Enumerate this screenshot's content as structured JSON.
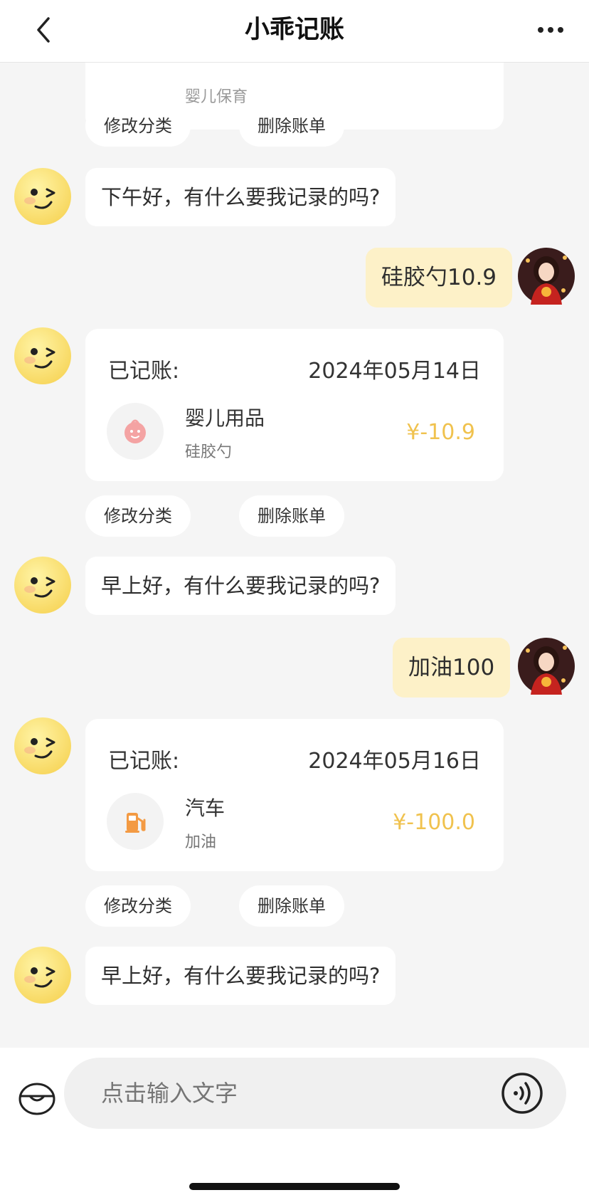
{
  "header": {
    "title": "小乖记账",
    "back_icon": "chevron-left-icon",
    "more_icon": "more-horizontal-icon"
  },
  "chat": {
    "partial_top": {
      "cat_note": "婴儿保育"
    },
    "top_actions": {
      "edit_label": "修改分类",
      "delete_label": "删除账单"
    },
    "msg1": {
      "text": "下午好，有什么要我记录的吗?"
    },
    "user1": {
      "text": "硅胶勺10.9"
    },
    "card1": {
      "label": "已记账:",
      "date": "2024年05月14日",
      "category": "婴儿用品",
      "note": "硅胶勺",
      "amount": "¥-10.9",
      "icon": "baby-face-icon",
      "edit_label": "修改分类",
      "delete_label": "删除账单"
    },
    "msg2": {
      "text": "早上好，有什么要我记录的吗?"
    },
    "user2": {
      "text": "加油100"
    },
    "card2": {
      "label": "已记账:",
      "date": "2024年05月16日",
      "category": "汽车",
      "note": "加油",
      "amount": "¥-100.0",
      "icon": "fuel-pump-icon",
      "edit_label": "修改分类",
      "delete_label": "删除账单"
    },
    "msg3": {
      "text": "早上好，有什么要我记录的吗?"
    }
  },
  "input": {
    "placeholder": "点击输入文字",
    "wallet_icon": "wallet-icon",
    "voice_icon": "voice-icon"
  },
  "colors": {
    "accent": "#f0c24e",
    "user_bubble": "#fdf1c8",
    "background": "#f5f5f5"
  }
}
